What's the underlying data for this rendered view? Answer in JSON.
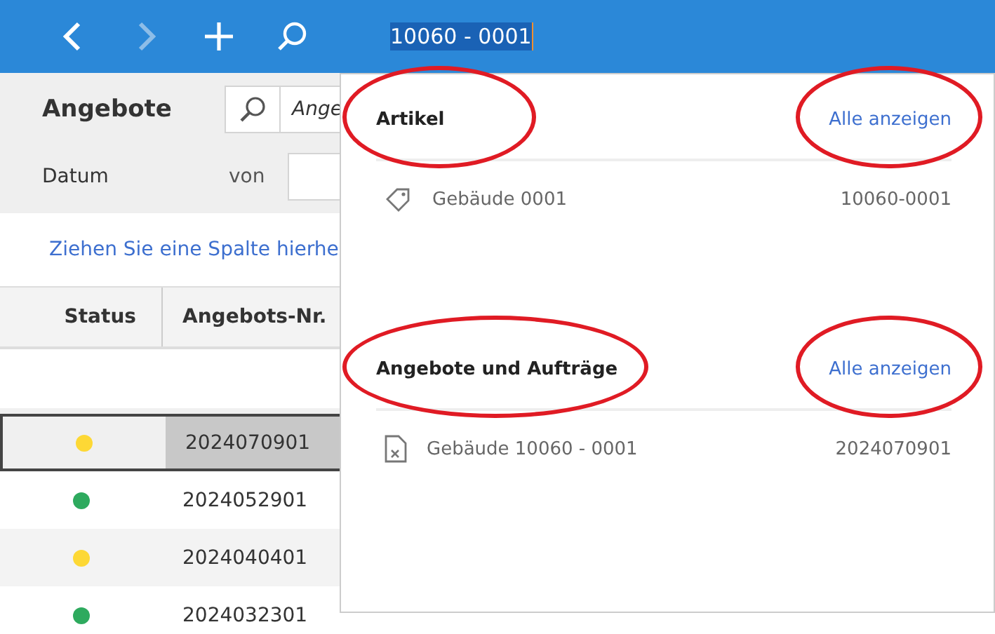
{
  "topbar": {
    "back_disabled": false,
    "forward_disabled": true,
    "search_value": "10060 - 0001"
  },
  "page": {
    "title": "Angebote",
    "search_value": "Ange",
    "date_label": "Datum",
    "from_label": "von"
  },
  "group_hint": "Ziehen Sie eine Spalte hierhe",
  "table": {
    "columns": [
      "Status",
      "Angebots-Nr."
    ],
    "rows": [
      {
        "color": "#fdd835",
        "number": "2024070901",
        "selected": true
      },
      {
        "color": "#2eaa5e",
        "number": "2024052901",
        "selected": false
      },
      {
        "color": "#fdd835",
        "number": "2024040401",
        "selected": false
      },
      {
        "color": "#2eaa5e",
        "number": "2024032301",
        "selected": false
      }
    ]
  },
  "popup": {
    "sections": [
      {
        "kind": "article",
        "title": "Artikel",
        "link": "Alle anzeigen",
        "circled": true,
        "items": [
          {
            "name": "Gebäude 0001",
            "code": "10060-0001"
          }
        ]
      },
      {
        "kind": "offer",
        "title": "Angebote und Aufträge",
        "link": "Alle anzeigen",
        "circled": true,
        "items": [
          {
            "name": "Gebäude 10060 - 0001",
            "code": "2024070901"
          }
        ]
      }
    ]
  }
}
